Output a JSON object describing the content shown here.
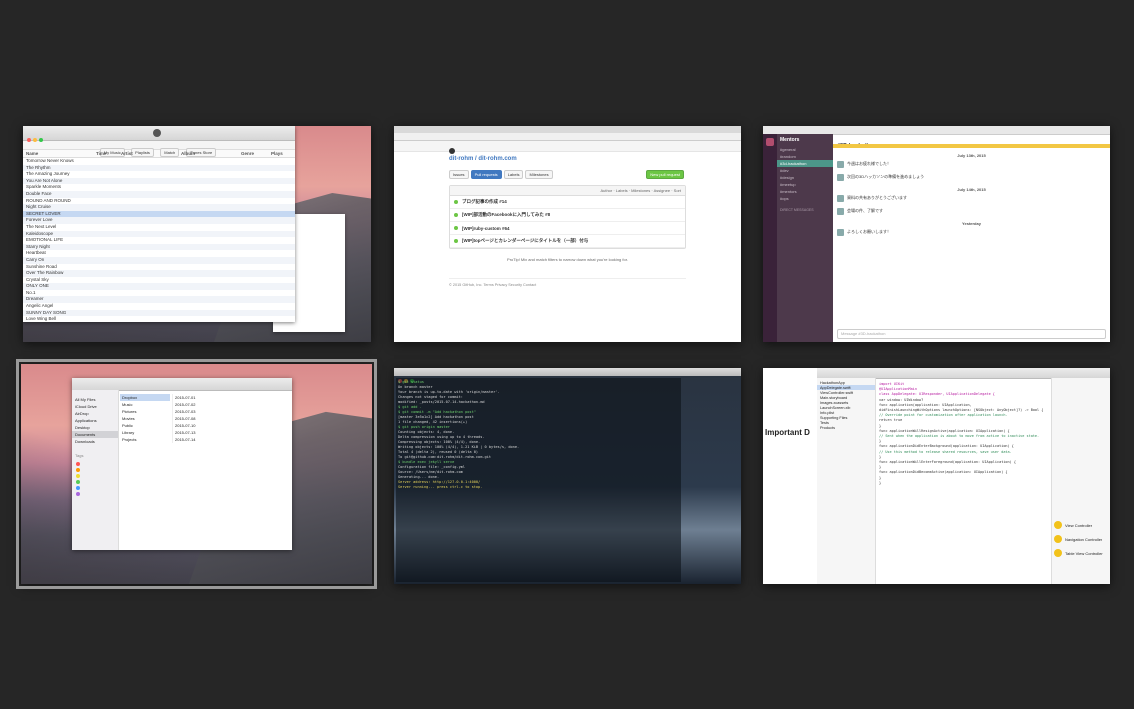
{
  "windows": {
    "itunes": {
      "tabs": [
        "My Music",
        "Playlists",
        "Match",
        "iTunes Store"
      ],
      "columns": [
        "Name",
        "Time",
        "Artist",
        "Album",
        "Genre",
        "Plays"
      ],
      "rows": [
        "Tomorrow Never Knows",
        "The Rhythm",
        "The Amazing Journey",
        "You Are Not Alone",
        "Sparkle Moments",
        "Double Face",
        "ROUND AND ROUND",
        "Night Cruise",
        "SECRET LOVER",
        "Forever Love",
        "The Next Level",
        "Kaleidoscope",
        "EMOTIONAL LIFE",
        "Starry Night",
        "Heartbeat",
        "Carry On",
        "Sunshine Road",
        "Over The Rainbow",
        "Crystal Sky",
        "ONLY ONE",
        "No.1",
        "Dreamer",
        "Angelic Angel",
        "SUNNY DAY SONG",
        "Love Wing Bell"
      ]
    },
    "github": {
      "repo_path": "dit-rohm / dit-rohm.com",
      "tabs": [
        "Issues",
        "Pull requests",
        "Labels",
        "Milestones"
      ],
      "new_button": "New pull request",
      "filters": [
        "Author",
        "Labels",
        "Milestones",
        "Assignee",
        "Sort"
      ],
      "prs": [
        "ブログ記事の作成 #14",
        "[WIP]部活動のFacebookに入門してみた #8",
        "[WIP]ruby-custom #64",
        "[WIP]topページとカレンダーページにタイトルを（一部）付与"
      ],
      "tip": "ProTip! Mix and match filters to narrow down what you're looking for.",
      "footer": "© 2015 GitHub, Inc.  Terms  Privacy  Security  Contact"
    },
    "slack": {
      "team": "Mentors",
      "channel": "#3D-hackathon",
      "sidebar": [
        "#general",
        "#random",
        "#3d-hackathon",
        "#dev",
        "#design",
        "#meetup",
        "#mentors",
        "#ops"
      ],
      "dm_header": "DIRECT MESSAGES",
      "date1": "July 13th, 2015",
      "date2": "July 14th, 2015",
      "divider": "Yesterday",
      "messages": [
        "今週はお疲れ様でした！",
        "次回の3Dハッカソンの準備を進めましょう",
        "資料の共有ありがとうございます",
        "会場の件、了解です",
        "よろしくお願いします！"
      ],
      "input_placeholder": "Message #3D-hackathon"
    },
    "finder": {
      "sidebar_favorites": [
        "All My Files",
        "iCloud Drive",
        "AirDrop",
        "Applications",
        "Desktop",
        "Documents",
        "Downloads"
      ],
      "col1": [
        "Dropbox",
        "Music",
        "Pictures",
        "Movies",
        "Public",
        "Library",
        "Projects"
      ],
      "col2": [
        "2015-07-01",
        "2015-07-02",
        "2015-07-03",
        "2015-07-08",
        "2015-07-10",
        "2015-07-13",
        "2015-07-14"
      ],
      "tags_label": "Tags"
    },
    "terminal": {
      "lines": [
        "$ git status",
        "On branch master",
        "Your branch is up-to-date with 'origin/master'.",
        "Changes not staged for commit:",
        "  modified:   _posts/2015-07-14-hackathon.md",
        "$ git add .",
        "$ git commit -m \"Add hackathon post\"",
        "[master 3e5a1c2] Add hackathon post",
        " 1 file changed, 42 insertions(+)",
        "$ git push origin master",
        "Counting objects: 4, done.",
        "Delta compression using up to 4 threads.",
        "Compressing objects: 100% (4/4), done.",
        "Writing objects: 100% (4/4), 1.21 KiB | 0 bytes/s, done.",
        "Total 4 (delta 2), reused 0 (delta 0)",
        "To git@github.com:dit-rohm/dit-rohm.com.git",
        "$ bundle exec jekyll serve",
        "Configuration file: _config.yml",
        "Source: /Users/me/dit-rohm.com",
        "Generating... done.",
        "Server address: http://127.0.0.1:4000/",
        "Server running... press ctrl-c to stop."
      ]
    },
    "xcode": {
      "article_heading": "Important D",
      "navigator": [
        "HackathonApp",
        "AppDelegate.swift",
        "ViewController.swift",
        "Main.storyboard",
        "Images.xcassets",
        "LaunchScreen.xib",
        "Info.plist",
        "Supporting Files",
        "Tests",
        "Products"
      ],
      "code": [
        "import UIKit",
        "",
        "@UIApplicationMain",
        "class AppDelegate: UIResponder, UIApplicationDelegate {",
        "    var window: UIWindow?",
        "",
        "    func application(application: UIApplication,",
        "        didFinishLaunchingWithOptions launchOptions: [NSObject: AnyObject]?) -> Bool {",
        "        // Override point for customization after application launch.",
        "        return true",
        "    }",
        "",
        "    func applicationWillResignActive(application: UIApplication) {",
        "        // Sent when the application is about to move from active to inactive state.",
        "    }",
        "",
        "    func applicationDidEnterBackground(application: UIApplication) {",
        "        // Use this method to release shared resources, save user data.",
        "    }",
        "",
        "    func applicationWillEnterForeground(application: UIApplication) {",
        "    }",
        "",
        "    func applicationDidBecomeActive(application: UIApplication) {",
        "    }",
        "}"
      ],
      "library_items": [
        "View Controller",
        "Navigation Controller",
        "Table View Controller"
      ]
    }
  }
}
